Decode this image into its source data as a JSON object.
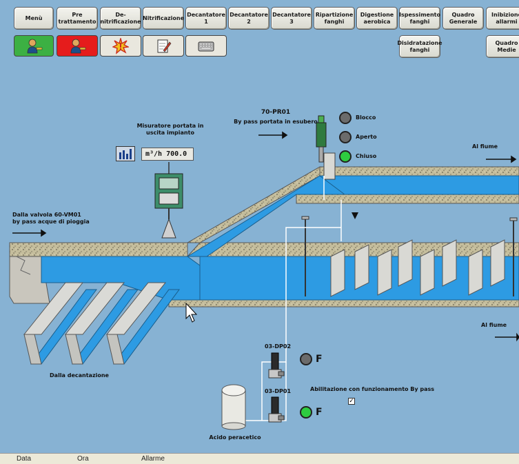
{
  "nav": {
    "row1": [
      "Menù",
      "Pre\ntrattamento",
      "De-\nnitrificazione",
      "Nitrificazione",
      "Decantatore\n1",
      "Decantatore\n2",
      "Decantatore\n3",
      "Ripartizione\nfanghi",
      "Digestione\naerobica",
      "Ispessimento\nfanghi",
      "Quadro\nGenerale",
      "Inibizione\nallarmi"
    ],
    "row2": [
      "Disidratazione\nfanghi",
      "Quadro\nMedie"
    ]
  },
  "toolbar_icons": [
    {
      "name": "user-login-icon",
      "color": "#3cb043"
    },
    {
      "name": "user-logout-icon",
      "color": "#e51c1c"
    },
    {
      "name": "alarm-burst-icon",
      "color": "#cc2b1d"
    },
    {
      "name": "notepad-icon",
      "color": "#e3e3e3"
    },
    {
      "name": "keyboard-icon",
      "color": "#e3e3e3"
    }
  ],
  "labels": {
    "flowmeter_title": "Misuratore portata in\nuscita impianto",
    "flow_value": "m³/h  700.0",
    "valve_id": "70-PR01",
    "bypass_text": "By pass portata in esubero",
    "status_blocco": "Blocco",
    "status_aperto": "Aperto",
    "status_chiuso": "Chiuso",
    "al_fiume_1": "Al fiume",
    "al_fiume_2": "Al fiume",
    "from_valve": "Dalla valvola 60-VM01\nby pass acque di pioggia",
    "dalla_decantazione": "Dalla decantazione",
    "pump1": "03-DP02",
    "pump2": "03-DP01",
    "pump1_state": "F",
    "pump2_state": "F",
    "abilitazione": "Abilitazione con funzionamento By pass",
    "abilitazione_check": "✓",
    "acido": "Acido peracetico"
  },
  "colors": {
    "water": "#2d9be3",
    "led_green": "#2ecc40",
    "led_off": "#6b6b6b",
    "background": "#87b2d3"
  },
  "statusbar": {
    "data": "Data",
    "ora": "Ora",
    "allarme": "Allarme"
  }
}
